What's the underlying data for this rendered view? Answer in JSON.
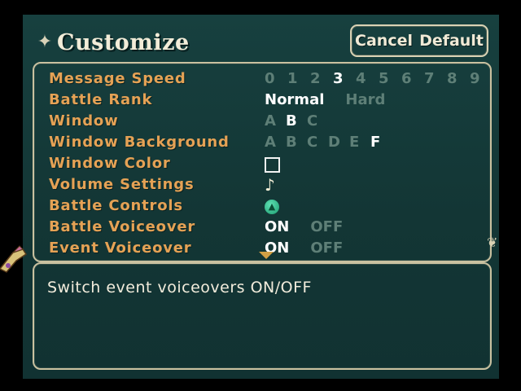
{
  "header": {
    "title": "Customize",
    "cancel_label": "Cancel",
    "default_label": "Default"
  },
  "options": {
    "message_speed": {
      "label": "Message Speed",
      "values": [
        "0",
        "1",
        "2",
        "3",
        "4",
        "5",
        "6",
        "7",
        "8",
        "9"
      ],
      "selected": "3"
    },
    "battle_rank": {
      "label": "Battle Rank",
      "values": [
        "Normal",
        "Hard"
      ],
      "selected": "Normal"
    },
    "window": {
      "label": "Window",
      "values": [
        "A",
        "B",
        "C"
      ],
      "selected": "B"
    },
    "window_background": {
      "label": "Window Background",
      "values": [
        "A",
        "B",
        "C",
        "D",
        "E",
        "F"
      ],
      "selected": "F"
    },
    "window_color": {
      "label": "Window Color"
    },
    "volume_settings": {
      "label": "Volume Settings",
      "icon": "♪"
    },
    "battle_controls": {
      "label": "Battle Controls"
    },
    "battle_voiceover": {
      "label": "Battle Voiceover",
      "values": [
        "ON",
        "OFF"
      ],
      "selected": "ON"
    },
    "event_voiceover": {
      "label": "Event Voiceover",
      "values": [
        "ON",
        "OFF"
      ],
      "selected": "ON"
    }
  },
  "help": {
    "text": "Switch event voiceovers ON/OFF"
  },
  "colors": {
    "label": "#e5a255",
    "selected": "#ffffff",
    "unselected": "#5e7f77",
    "background": "#15393a",
    "frame": "#c9c1a0"
  }
}
